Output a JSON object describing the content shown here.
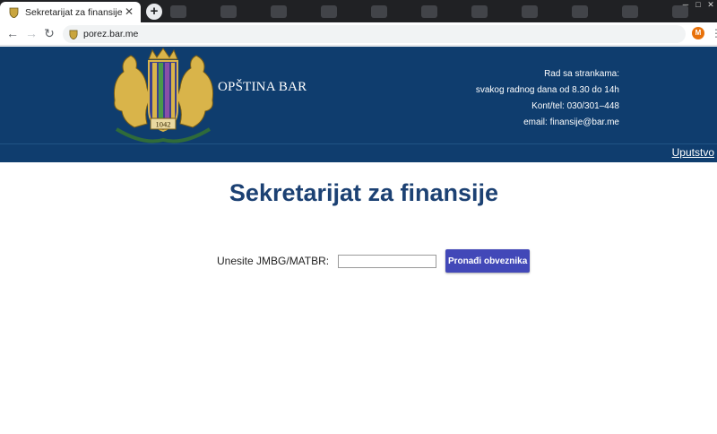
{
  "browser": {
    "tab_title": "Sekretarijat za finansije",
    "tab_close": "✕",
    "new_tab": "+",
    "url": "porez.bar.me",
    "profile_initial": "M",
    "back": "←",
    "forward": "→",
    "reload": "↻",
    "menu": "⋮"
  },
  "header": {
    "municipality": "OPŠTINA BAR",
    "crest_year": "1042",
    "contact": {
      "hours_label": "Rad sa strankama:",
      "hours": "svakog radnog dana od 8.30 do 14h",
      "phone": "Kont/tel: 030/301–448",
      "email": "email: finansije@bar.me"
    },
    "help_link": "Uputstvo"
  },
  "main": {
    "title": "Sekretarijat za finansije",
    "search_label": "Unesite JMBG/MATBR:",
    "search_value": "",
    "search_button": "Pronađi obveznika"
  },
  "colors": {
    "header_bg": "#0f3d6e",
    "title": "#1c4173",
    "button": "#4248b8",
    "crest_gold": "#d9b44a"
  }
}
